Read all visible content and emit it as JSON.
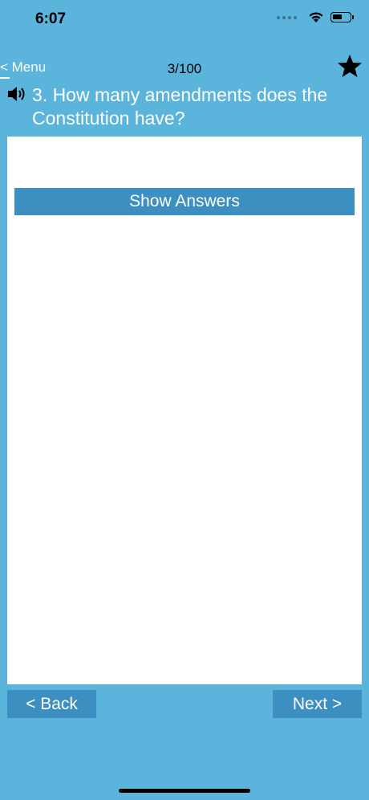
{
  "status_bar": {
    "time": "6:07",
    "battery_level": 0.6,
    "icons": [
      "signal-dots",
      "wifi-icon",
      "battery-icon"
    ]
  },
  "nav": {
    "menu_label": "< Menu",
    "counter": "3/100",
    "favorite_icon": "star-icon"
  },
  "question": {
    "text": "3. How many amendments does the Constitution have?",
    "audio_icon": "speaker-icon"
  },
  "answer_panel": {
    "show_answers_label": "Show Answers"
  },
  "footer": {
    "back_label": "< Back",
    "next_label": "Next >"
  },
  "colors": {
    "background": "#5ab4dc",
    "button": "#3d8fc1",
    "panel": "#ffffff"
  }
}
